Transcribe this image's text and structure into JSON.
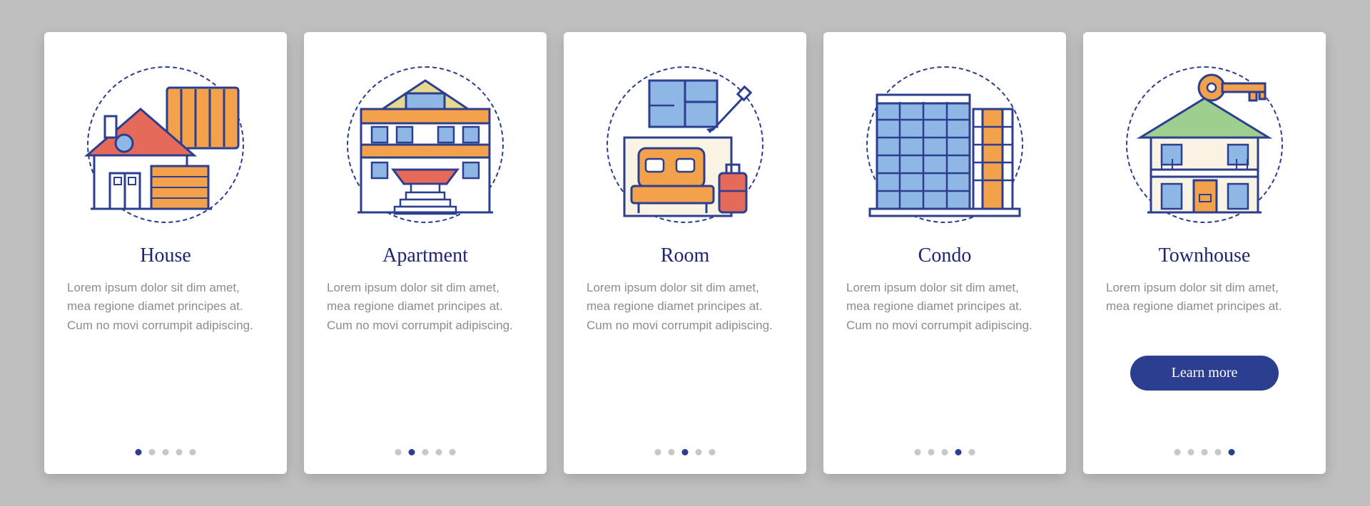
{
  "lorem_long": "Lorem ipsum dolor sit dim amet, mea regione diamet principes at. Cum no movi corrumpit adipiscing.",
  "lorem_short": "Lorem ipsum dolor sit dim amet, mea regione diamet principes at.",
  "button_label": "Learn more",
  "colors": {
    "primary": "#2b3e8f",
    "title": "#1d2470",
    "accent_orange": "#f3a14a",
    "accent_red": "#e66a59",
    "accent_green": "#9ecf8f",
    "accent_blue": "#8fb7e6"
  },
  "cards": [
    {
      "id": "house",
      "title": "House",
      "icon": "house-icon",
      "desc_key": "lorem_long",
      "active_dot": 0,
      "has_button": false
    },
    {
      "id": "apartment",
      "title": "Apartment",
      "icon": "apartment-icon",
      "desc_key": "lorem_long",
      "active_dot": 1,
      "has_button": false
    },
    {
      "id": "room",
      "title": "Room",
      "icon": "room-icon",
      "desc_key": "lorem_long",
      "active_dot": 2,
      "has_button": false
    },
    {
      "id": "condo",
      "title": "Condo",
      "icon": "condo-icon",
      "desc_key": "lorem_long",
      "active_dot": 3,
      "has_button": false
    },
    {
      "id": "townhouse",
      "title": "Townhouse",
      "icon": "townhouse-icon",
      "desc_key": "lorem_short",
      "active_dot": 4,
      "has_button": true
    }
  ]
}
